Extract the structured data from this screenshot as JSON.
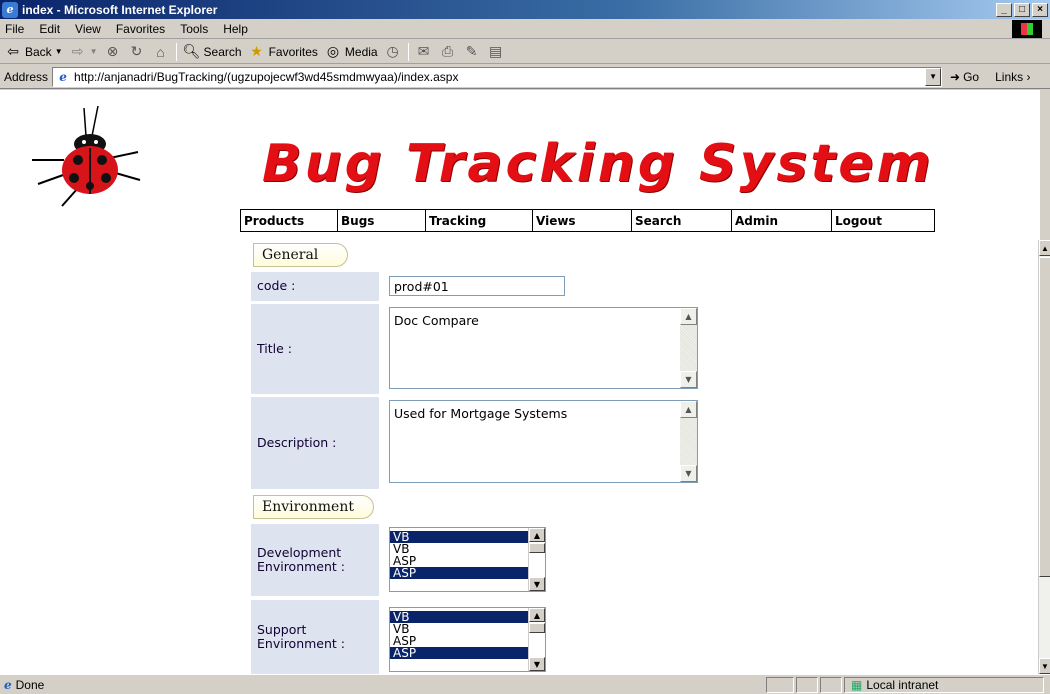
{
  "window": {
    "title": "index - Microsoft Internet Explorer",
    "controls": {
      "minimize": "_",
      "maximize": "□",
      "close": "×"
    }
  },
  "menu": [
    "File",
    "Edit",
    "View",
    "Favorites",
    "Tools",
    "Help"
  ],
  "toolbar": {
    "back_label": "Back",
    "search_label": "Search",
    "favorites_label": "Favorites",
    "media_label": "Media"
  },
  "address": {
    "label": "Address",
    "url": "http://anjanadri/BugTracking/(ugzupojecwf3wd45smdmwyaa)/index.aspx",
    "go_label": "Go",
    "links_label": "Links ›"
  },
  "page": {
    "brand": "Bug Tracking System",
    "nav": [
      "Products",
      "Bugs",
      "Tracking",
      "Views",
      "Search",
      "Admin",
      "Logout"
    ],
    "general_tab": "General",
    "environment_tab": "Environment",
    "fields": {
      "code_label": "code :",
      "code_value": "prod#01",
      "title_label": "Title :",
      "title_value": "Doc Compare",
      "description_label": "Description :",
      "description_value": "Used for Mortgage Systems",
      "dev_env_label_1": "Development",
      "dev_env_label_2": "Environment :",
      "support_env_label_1": "Support",
      "support_env_label_2": "Environment :"
    },
    "dev_env_options": [
      {
        "text": "VB",
        "selected": true
      },
      {
        "text": "VB",
        "selected": false
      },
      {
        "text": "ASP",
        "selected": false
      },
      {
        "text": "ASP",
        "selected": true
      }
    ],
    "support_env_options": [
      {
        "text": "VB",
        "selected": true
      },
      {
        "text": "VB",
        "selected": false
      },
      {
        "text": "ASP",
        "selected": false
      },
      {
        "text": "ASP",
        "selected": true
      }
    ]
  },
  "status": {
    "text": "Done",
    "zone": "Local intranet"
  }
}
